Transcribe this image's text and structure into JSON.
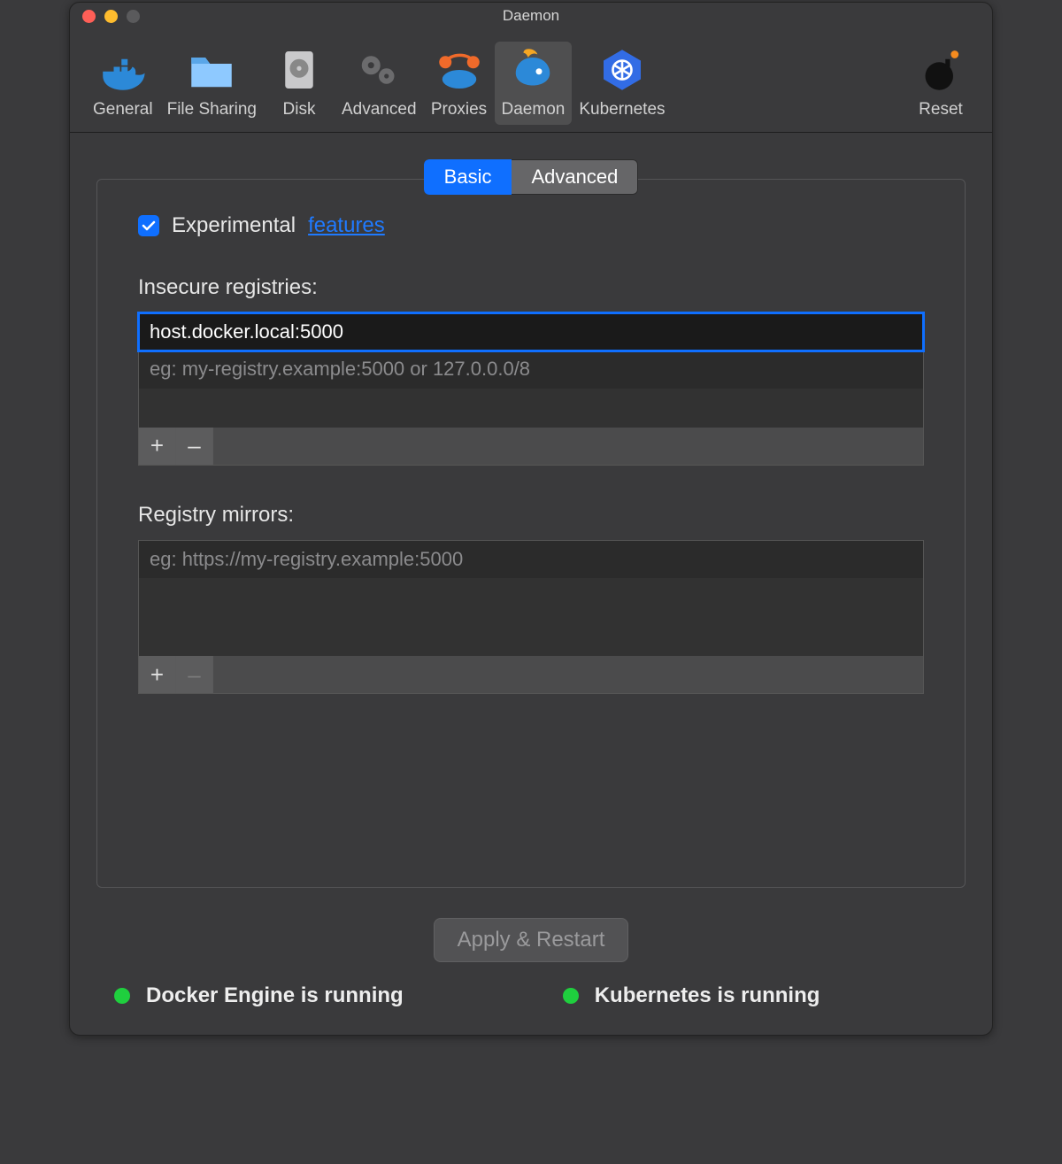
{
  "window": {
    "title": "Daemon"
  },
  "toolbar": {
    "items": [
      {
        "id": "general",
        "label": "General"
      },
      {
        "id": "file-sharing",
        "label": "File Sharing"
      },
      {
        "id": "disk",
        "label": "Disk"
      },
      {
        "id": "advanced",
        "label": "Advanced"
      },
      {
        "id": "proxies",
        "label": "Proxies"
      },
      {
        "id": "daemon",
        "label": "Daemon"
      },
      {
        "id": "kubernetes",
        "label": "Kubernetes"
      }
    ],
    "reset_label": "Reset"
  },
  "tabs": {
    "basic": "Basic",
    "advanced": "Advanced",
    "active": "basic"
  },
  "experimental": {
    "checked": true,
    "label": "Experimental",
    "link_text": "features"
  },
  "insecure_registries": {
    "label": "Insecure registries:",
    "value": "host.docker.local:5000",
    "placeholder": "eg: my-registry.example:5000 or 127.0.0.0/8",
    "add": "+",
    "remove": "–"
  },
  "registry_mirrors": {
    "label": "Registry mirrors:",
    "placeholder": "eg: https://my-registry.example:5000",
    "add": "+",
    "remove": "–"
  },
  "apply": {
    "label": "Apply & Restart"
  },
  "status": {
    "docker": "Docker Engine is running",
    "kubernetes": "Kubernetes is running"
  }
}
